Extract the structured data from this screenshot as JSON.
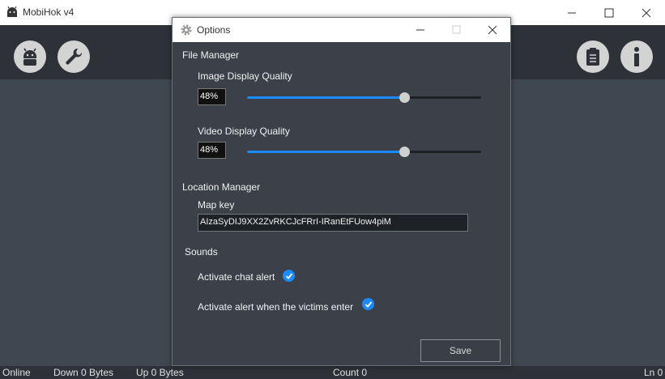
{
  "app": {
    "title": "MobiHok v4",
    "icon": "android-robot-icon"
  },
  "toolbar": {
    "left_buttons": [
      "android-icon",
      "wrench-icon"
    ],
    "right_buttons": [
      "clipboard-icon",
      "info-icon"
    ]
  },
  "status": {
    "online": "Online",
    "down": "Down 0 Bytes",
    "up": "Up 0 Bytes",
    "count": "Count 0",
    "ln": "Ln 0"
  },
  "dialog": {
    "title": "Options",
    "file_manager": {
      "heading": "File Manager",
      "image_quality": {
        "label": "Image Display Quality",
        "value": "48%",
        "level": 0.67
      },
      "video_quality": {
        "label": "Video Display Quality",
        "value": "48%",
        "level": 0.67
      }
    },
    "location_manager": {
      "heading": "Location Manager",
      "map_key_label": "Map key",
      "map_key_value": "AIzaSyDIJ9XX2ZvRKCJcFRrI-IRanEtFUow4piM"
    },
    "sounds": {
      "heading": "Sounds",
      "chat_alert": {
        "label": "Activate chat alert",
        "checked": true
      },
      "victims_alert": {
        "label": "Activate alert when the victims enter",
        "checked": true
      }
    },
    "save_label": "Save"
  },
  "colors": {
    "accent": "#1a8cff",
    "background": "#3f4751",
    "toolbar": "#2e3238"
  }
}
